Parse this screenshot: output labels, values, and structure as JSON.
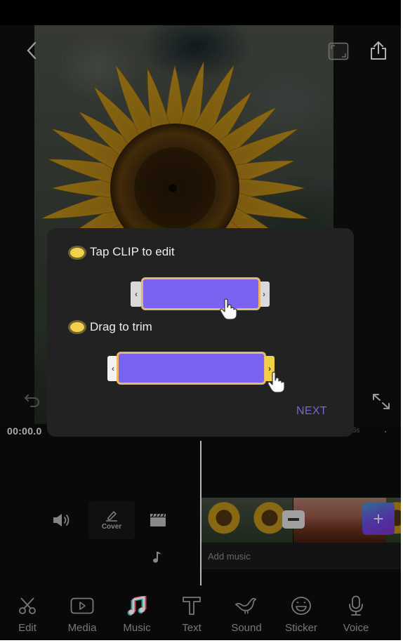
{
  "header": {
    "back_icon": "chevron-left-icon",
    "aspect_ratio_icon": "aspect-ratio-icon",
    "share_icon": "share-icon"
  },
  "preview": {
    "image": "sunflower",
    "undo_icon": "undo-icon",
    "fullscreen_icon": "expand-icon"
  },
  "timeline": {
    "current_time": "00:00.0",
    "end_time_partial": "5s",
    "track_tools": {
      "volume_icon": "volume-icon",
      "cover_label": "Cover",
      "cover_icon": "pencil-icon",
      "clapper_icon": "clapperboard-icon",
      "music_icon": "music-note-icon"
    },
    "clips": [
      {
        "type": "sunflower"
      },
      {
        "type": "sunflower"
      },
      {
        "type": "sunset-field"
      },
      {
        "type": "sunset-field"
      }
    ],
    "remove_transition_label": "−",
    "add_clip_label": "+",
    "add_music_label": "Add music"
  },
  "tutorial": {
    "tip1": "Tap CLIP to edit",
    "tip2": "Drag to trim",
    "next_label": "NEXT",
    "accent_color": "#7b63f2",
    "bullet_color": "#f1d24a"
  },
  "bottom_nav": [
    {
      "label": "Edit",
      "icon": "scissors-icon"
    },
    {
      "label": "Media",
      "icon": "media-play-icon"
    },
    {
      "label": "Music",
      "icon": "music-icon",
      "active": true
    },
    {
      "label": "Text",
      "icon": "text-icon"
    },
    {
      "label": "Sound",
      "icon": "bird-icon"
    },
    {
      "label": "Sticker",
      "icon": "sticker-face-icon"
    },
    {
      "label": "Voice",
      "icon": "microphone-icon"
    }
  ]
}
